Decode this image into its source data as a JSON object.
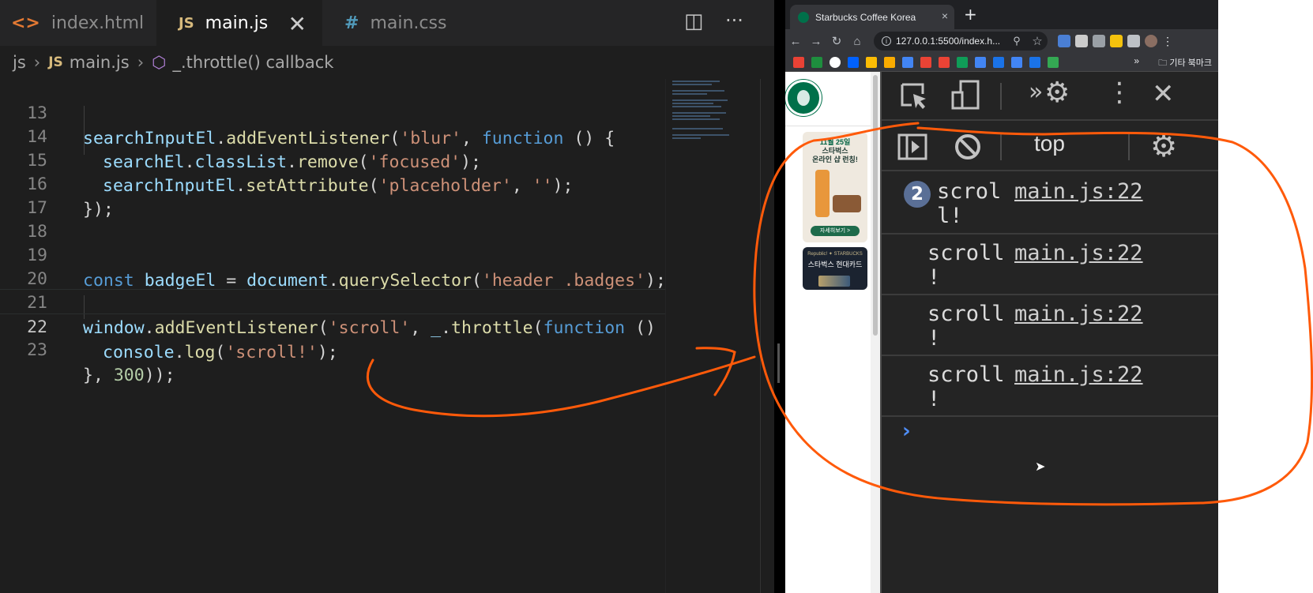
{
  "editor": {
    "tabs": [
      {
        "icon": "<>",
        "label": "index.html"
      },
      {
        "icon": "JS",
        "label": "main.js"
      },
      {
        "icon": "#",
        "label": "main.css"
      }
    ],
    "close_glyph": "✕",
    "split_glyph": "◫",
    "more_glyph": "···",
    "breadcrumb": {
      "folder": "js",
      "file_icon": "JS",
      "file": "main.js",
      "symbol": "_.throttle() callback"
    },
    "lines": [
      {
        "n": "13"
      },
      {
        "n": "14"
      },
      {
        "n": "15"
      },
      {
        "n": "16"
      },
      {
        "n": "17"
      },
      {
        "n": "18"
      },
      {
        "n": "19"
      },
      {
        "n": "20"
      },
      {
        "n": "21"
      },
      {
        "n": "22"
      },
      {
        "n": "23"
      }
    ],
    "tokens": {
      "l13": [
        "searchInputEl",
        ".",
        "addEventListener",
        "(",
        "'blur'",
        ", ",
        "function",
        " () {"
      ],
      "l14": [
        "searchEl",
        ".",
        "classList",
        ".",
        "remove",
        "(",
        "'focused'",
        ");"
      ],
      "l15": [
        "searchInputEl",
        ".",
        "setAttribute",
        "(",
        "'placeholder'",
        ", ",
        "''",
        ");"
      ],
      "l16": [
        "});"
      ],
      "l19": [
        "const",
        " ",
        "badgeEl",
        " = ",
        "document",
        ".",
        "querySelector",
        "(",
        "'header .badges'",
        ");"
      ],
      "l21": [
        "window",
        ".",
        "addEventListener",
        "(",
        "'scroll'",
        ", ",
        "_",
        ".",
        "throttle",
        "(",
        "function",
        " () {"
      ],
      "l22": [
        "console",
        ".",
        "log",
        "(",
        "'scroll!'",
        ");"
      ],
      "l23": [
        "}",
        ", ",
        "300",
        "));"
      ]
    }
  },
  "browser": {
    "tab_title": "Starbucks Coffee Korea",
    "tab_close": "×",
    "new_tab": "+",
    "url": "127.0.0.1:5500/index.h...",
    "info_glyph": "i",
    "bookmarks_more": "»",
    "bookmarks_folder": "기타 북마크",
    "page": {
      "badge1_date": "11월 25일",
      "badge1_line1": "스타벅스",
      "badge1_line2": "온라인 샵 런칭!",
      "badge1_button": "자세히보기 >",
      "badge2_brand": "Republic! ✦ STARBUCKS",
      "badge2_title": "스타벅스 현대카드"
    }
  },
  "devtools": {
    "context": "top",
    "messages": [
      {
        "count": "2",
        "text": "scrol\nl!",
        "source": "main.js:22"
      },
      {
        "text": "scroll\n!",
        "source": "main.js:22"
      },
      {
        "text": "scroll\n!",
        "source": "main.js:22"
      },
      {
        "text": "scroll\n!",
        "source": "main.js:22"
      }
    ],
    "prompt": "›"
  },
  "colors": {
    "annotation": "#ff5a0a",
    "editor_bg": "#1e1e1e",
    "devtools_bg": "#242424",
    "starbucks_green": "#00704a"
  }
}
